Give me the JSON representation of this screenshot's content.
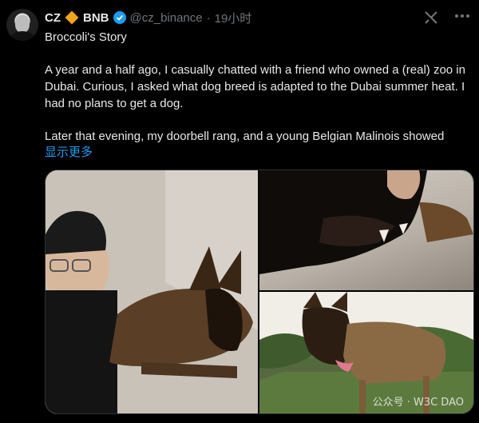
{
  "tweet": {
    "author_name": "CZ",
    "brand_label": "BNB",
    "handle": "@cz_binance",
    "separator": "·",
    "time": "19小时",
    "title": "Broccoli's Story",
    "paragraph1": "A year and a half ago, I casually chatted with a friend who owned a (real) zoo in Dubai. Curious, I asked what dog breed is adapted to the Dubai summer heat. I had no plans to get a dog.",
    "paragraph2": "Later that evening, my doorbell rang, and a young Belgian Malinois showed",
    "show_more": "显示更多",
    "watermark": "公众号 · W3C DAO"
  },
  "icons": {
    "brand": "diamond-icon",
    "verified": "verified-badge-icon",
    "grok": "grok-icon",
    "more": "more-options-icon"
  },
  "colors": {
    "accent": "#1d9bf0",
    "brand_orange": "#f0a51c",
    "muted": "#71767b",
    "background": "#000000"
  }
}
